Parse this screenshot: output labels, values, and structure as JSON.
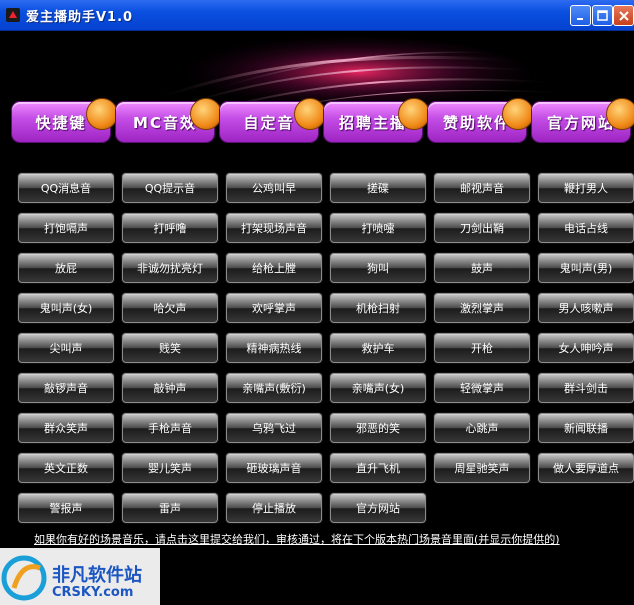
{
  "window": {
    "title": "爱主播助手V1.0"
  },
  "nav": [
    {
      "label": "快捷键"
    },
    {
      "label": "MC音效"
    },
    {
      "label": "自定音"
    },
    {
      "label": "招聘主播"
    },
    {
      "label": "赞助软件"
    },
    {
      "label": "官方网站"
    }
  ],
  "sounds": [
    "QQ消息音",
    "QQ提示音",
    "公鸡叫早",
    "搓碟",
    "邮视声音",
    "鞭打男人",
    "打饱嗝声",
    "打呼噜",
    "打架现场声音",
    "打喷嚏",
    "刀剑出鞘",
    "电话占线",
    "放屁",
    "非诚勿扰亮灯",
    "给枪上膛",
    "狗叫",
    "鼓声",
    "鬼叫声(男)",
    "鬼叫声(女)",
    "哈欠声",
    "欢呼掌声",
    "机枪扫射",
    "激烈掌声",
    "男人咳嗽声",
    "尖叫声",
    "贱笑",
    "精神病热线",
    "救护车",
    "开枪",
    "女人呻吟声",
    "敲锣声音",
    "敲钟声",
    "亲嘴声(敷衍)",
    "亲嘴声(女)",
    "轻微掌声",
    "群斗剑击",
    "群众笑声",
    "手枪声音",
    "乌鸦飞过",
    "邪恶的笑",
    "心跳声",
    "新闻联播",
    "英文正数",
    "婴儿笑声",
    "砸玻璃声音",
    "直升飞机",
    "周星驰笑声",
    "做人要厚道点",
    "警报声",
    "雷声",
    "停止播放",
    "官方网站"
  ],
  "notice": "如果你有好的场景音乐，请点击这里提交给我们，审核通过，将在下个版本热门场景音里面(并显示你提供的)",
  "watermark": {
    "main": "非凡软件站",
    "sub": "CRSKY.com"
  }
}
